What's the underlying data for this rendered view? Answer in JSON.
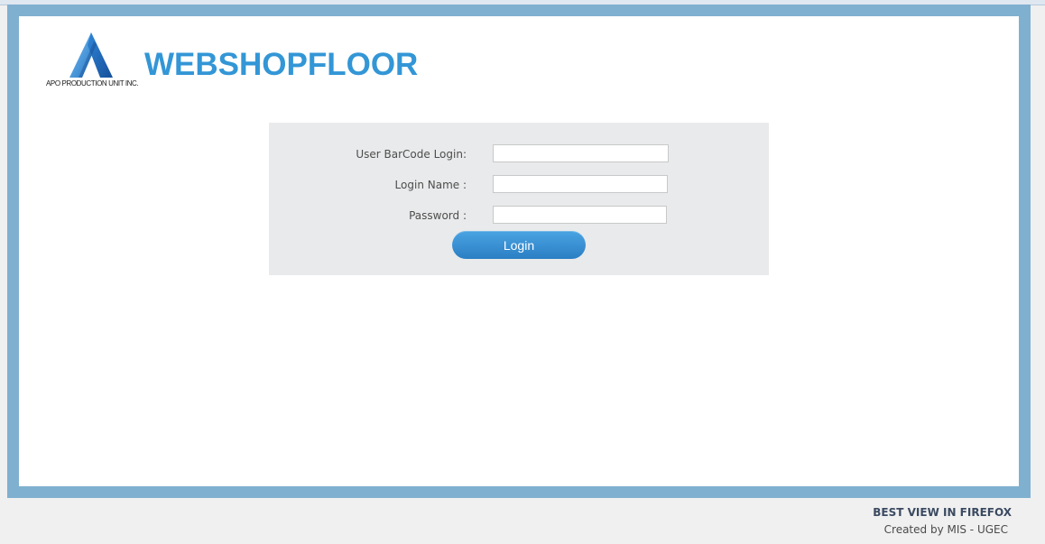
{
  "header": {
    "logo_text": "APO PRODUCTION UNIT INC.",
    "logo_icon": "apo-triangle-logo",
    "app_title": "WEBSHOPFLOOR"
  },
  "login_form": {
    "barcode_label": "User BarCode Login:",
    "barcode_value": "",
    "login_name_label": "Login Name :",
    "login_name_value": "",
    "password_label": "Password :",
    "password_value": "",
    "login_button": "Login"
  },
  "footer": {
    "browser_note": "BEST VIEW IN FIREFOX",
    "credits": "Created by MIS - UGEC"
  },
  "colors": {
    "frame": "#80b0cf",
    "title": "#3396d6",
    "panel": "#e9eaeb",
    "button": "#2b7fc4"
  }
}
